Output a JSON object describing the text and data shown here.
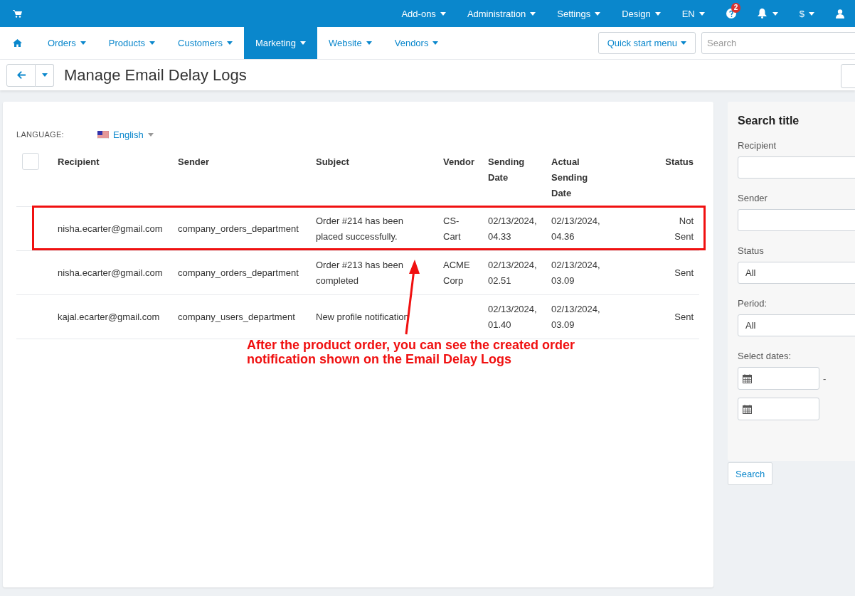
{
  "top_bar": {
    "menus": [
      {
        "label": "Add-ons"
      },
      {
        "label": "Administration"
      },
      {
        "label": "Settings"
      },
      {
        "label": "Design"
      },
      {
        "label": "EN"
      }
    ],
    "help_badge": "2",
    "currency": "$"
  },
  "nav": {
    "tabs": [
      {
        "label": "Orders",
        "selected": false
      },
      {
        "label": "Products",
        "selected": false
      },
      {
        "label": "Customers",
        "selected": false
      },
      {
        "label": "Marketing",
        "selected": true
      },
      {
        "label": "Website",
        "selected": false
      },
      {
        "label": "Vendors",
        "selected": false
      }
    ],
    "quick_start": "Quick start menu",
    "search": {
      "placeholder": "Search"
    }
  },
  "page_title": "Manage Email Delay Logs",
  "language": {
    "label": "LANGUAGE:",
    "value": "English"
  },
  "table": {
    "select_all": {
      "checked": false
    },
    "columns": [
      "Recipient",
      "Sender",
      "Subject",
      "Vendor",
      "Sending Date",
      "Actual Sending Date",
      "Status"
    ],
    "rows": [
      {
        "recipient": "nisha.ecarter@gmail.com",
        "sender": "company_orders_department",
        "subject": "Order #214 has been placed successfully.",
        "vendor": "CS-Cart",
        "sending_date": "02/13/2024, 04.33",
        "actual_sending_date": "02/13/2024, 04.36",
        "status": "Not Sent",
        "highlighted": true
      },
      {
        "recipient": "nisha.ecarter@gmail.com",
        "sender": "company_orders_department",
        "subject": "Order #213 has been completed",
        "vendor": "ACME Corp",
        "sending_date": "02/13/2024, 02.51",
        "actual_sending_date": "02/13/2024, 03.09",
        "status": "Sent",
        "highlighted": false
      },
      {
        "recipient": "kajal.ecarter@gmail.com",
        "sender": "company_users_department",
        "subject": "New profile notification",
        "sending_date": "02/13/2024, 01.40",
        "actual_sending_date": "02/13/2024, 03.09",
        "status": "Sent",
        "highlighted": false
      }
    ]
  },
  "annotation": "After the product order, you can see the created order notification shown on the Email Delay Logs",
  "search_panel": {
    "title": "Search title",
    "fields": [
      {
        "label": "Recipient",
        "kind": "text"
      },
      {
        "label": "Sender",
        "kind": "text"
      },
      {
        "label": "Status",
        "kind": "select",
        "value": "All"
      },
      {
        "label": "Period:",
        "kind": "select",
        "value": "All"
      },
      {
        "label": "Select dates:",
        "kind": "dates",
        "separator": "-"
      }
    ],
    "button": "Search"
  }
}
